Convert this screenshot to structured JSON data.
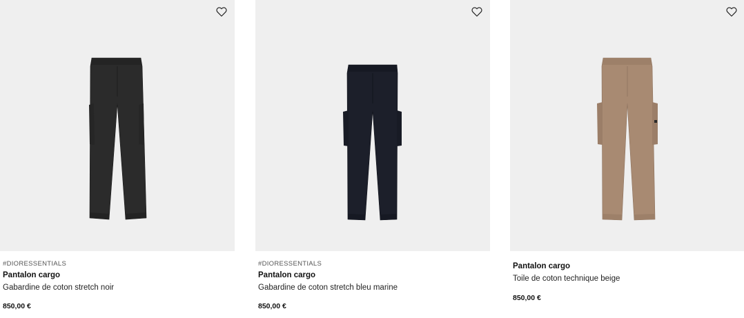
{
  "products": [
    {
      "tag": "#DIORESSENTIALS",
      "name": "Pantalon cargo",
      "description": "Gabardine de coton stretch noir",
      "price": "850,00 €",
      "color": "#2b2b2b"
    },
    {
      "tag": "#DIORESSENTIALS",
      "name": "Pantalon cargo",
      "description": "Gabardine de coton stretch bleu marine",
      "price": "850,00 €",
      "color": "#1c1f2a"
    },
    {
      "tag": "",
      "name": "Pantalon cargo",
      "description": "Toile de coton technique beige",
      "price": "850,00 €",
      "color": "#a88a72"
    }
  ],
  "icons": {
    "favorite": "heart-outline-icon"
  }
}
